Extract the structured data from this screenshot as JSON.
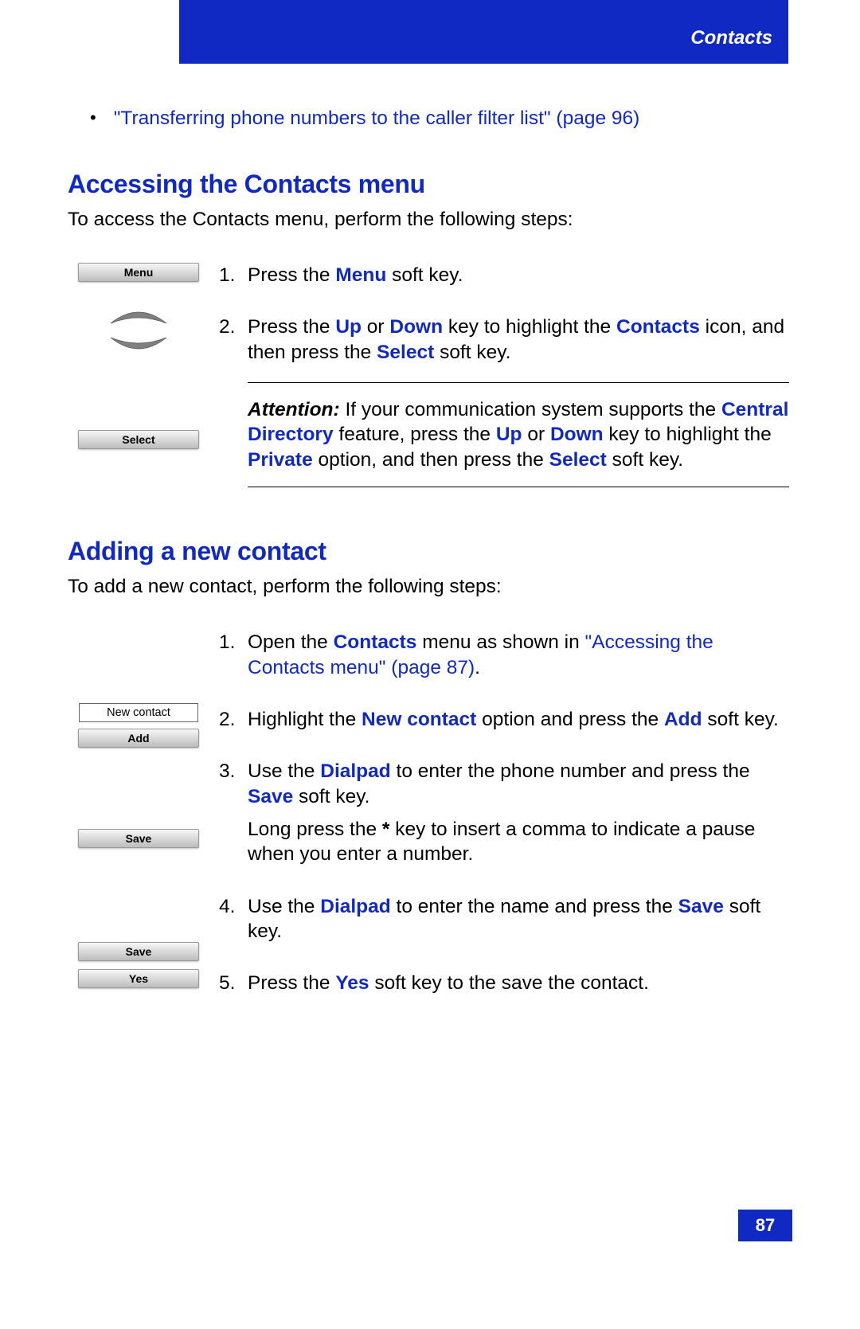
{
  "header": {
    "title": "Contacts"
  },
  "bullet": {
    "text": "\"Transferring phone numbers to the caller filter list\" (page 96)"
  },
  "section1": {
    "heading": "Accessing the Contacts menu",
    "intro": "To access the Contacts menu, perform the following steps:",
    "softkeys": {
      "menu": "Menu",
      "select": "Select"
    },
    "step1": {
      "num": "1.",
      "pre": "Press the ",
      "key": "Menu",
      "post": " soft key."
    },
    "step2": {
      "num": "2.",
      "t1": "Press the ",
      "k1": "Up",
      "t2": " or ",
      "k2": "Down",
      "t3": " key to highlight the ",
      "k3": "Contacts",
      "t4": " icon, and then press the ",
      "k4": "Select",
      "t5": " soft key."
    },
    "attention": {
      "label": "Attention:",
      "t1": " If your communication system supports the ",
      "k1": "Central Directory",
      "t2": " feature, press the ",
      "k2": "Up",
      "t3": " or ",
      "k3": "Down",
      "t4": " key to highlight the ",
      "k4": "Private",
      "t5": " option, and then press the ",
      "k5": "Select",
      "t6": " soft key."
    }
  },
  "section2": {
    "heading": "Adding a new contact",
    "intro": "To add a new contact, perform the following steps:",
    "labels": {
      "newcontact": "New contact",
      "add": "Add",
      "save": "Save",
      "save2": "Save",
      "yes": "Yes"
    },
    "step1": {
      "num": "1.",
      "t1": "Open the ",
      "k1": "Contacts",
      "t2": " menu as shown in ",
      "link": "\"Accessing the Contacts menu\" (page 87)",
      "t3": "."
    },
    "step2": {
      "num": "2.",
      "t1": "Highlight the ",
      "k1": "New contact",
      "t2": " option and press the ",
      "k2": "Add",
      "t3": " soft key."
    },
    "step3": {
      "num": "3.",
      "t1": "Use the ",
      "k1": "Dialpad",
      "t2": " to enter the phone number and press the ",
      "k2": "Save",
      "t3": " soft key.",
      "long1": "Long press the ",
      "star": "*",
      "long2": " key to insert a comma to indicate a pause when you enter a number."
    },
    "step4": {
      "num": "4.",
      "t1": "Use the ",
      "k1": "Dialpad",
      "t2": " to enter the name and press the ",
      "k2": "Save",
      "t3": " soft key."
    },
    "step5": {
      "num": "5.",
      "t1": "Press the ",
      "k1": "Yes",
      "t2": " soft key to the save the contact."
    }
  },
  "pageNumber": "87"
}
